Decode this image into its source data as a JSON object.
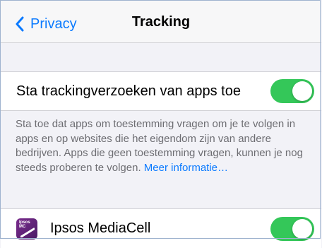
{
  "nav": {
    "back_label": "Privacy",
    "title": "Tracking"
  },
  "tracking_requests": {
    "label": "Sta trackingverzoeken van apps toe",
    "enabled": true
  },
  "footer": {
    "text": "Sta toe dat apps om toestemming vragen om je te volgen in apps en op websites die het eigendom zijn van andere bedrijven. Apps die geen toestemming vragen, kunnen je nog steeds proberen te volgen.",
    "link": "Meer informatie…"
  },
  "apps": [
    {
      "name": "Ipsos MediaCell",
      "icon_text_line1": "Ipsos",
      "icon_text_line2": "MC",
      "enabled": true
    }
  ],
  "colors": {
    "accent": "#0a7aff",
    "toggle_on": "#34c759",
    "background": "#f2f2f7"
  },
  "icons": {
    "back": "chevron-left-icon",
    "app": "ipsos-mediacell-app-icon"
  }
}
